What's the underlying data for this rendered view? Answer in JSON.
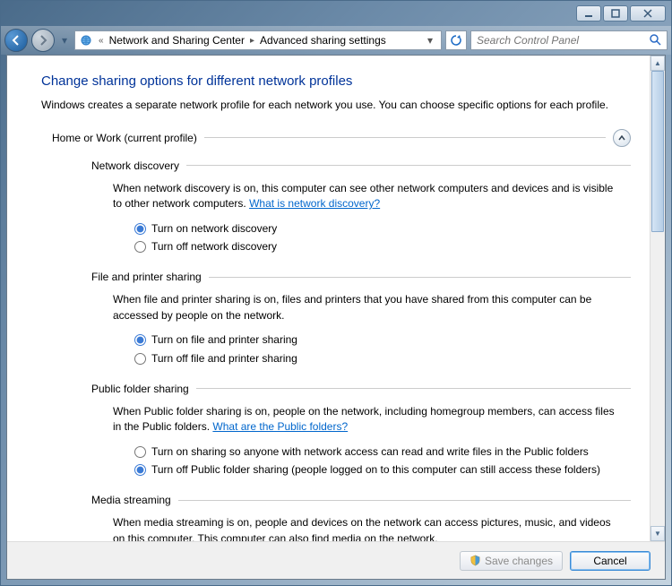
{
  "breadcrumb": {
    "level1": "Network and Sharing Center",
    "level2": "Advanced sharing settings"
  },
  "search": {
    "placeholder": "Search Control Panel"
  },
  "page": {
    "title": "Change sharing options for different network profiles",
    "description": "Windows creates a separate network profile for each network you use. You can choose specific options for each profile."
  },
  "profile": {
    "label": "Home or Work (current profile)"
  },
  "sections": {
    "network_discovery": {
      "title": "Network discovery",
      "description": "When network discovery is on, this computer can see other network computers and devices and is visible to other network computers. ",
      "help_link": "What is network discovery?",
      "options": {
        "on": "Turn on network discovery",
        "off": "Turn off network discovery"
      }
    },
    "file_printer": {
      "title": "File and printer sharing",
      "description": "When file and printer sharing is on, files and printers that you have shared from this computer can be accessed by people on the network.",
      "options": {
        "on": "Turn on file and printer sharing",
        "off": "Turn off file and printer sharing"
      }
    },
    "public_folder": {
      "title": "Public folder sharing",
      "description": "When Public folder sharing is on, people on the network, including homegroup members, can access files in the Public folders. ",
      "help_link": "What are the Public folders?",
      "options": {
        "on": "Turn on sharing so anyone with network access can read and write files in the Public folders",
        "off": "Turn off Public folder sharing (people logged on to this computer can still access these folders)"
      }
    },
    "media_streaming": {
      "title": "Media streaming",
      "description": "When media streaming is on, people and devices on the network can access pictures, music, and videos on this computer. This computer can also find media on the network."
    }
  },
  "buttons": {
    "save": "Save changes",
    "cancel": "Cancel"
  }
}
